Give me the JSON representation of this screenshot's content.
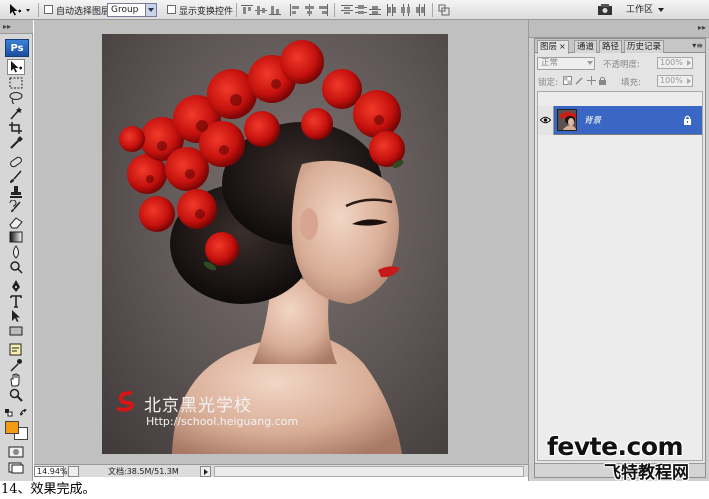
{
  "options_bar": {
    "auto_select_label": "自动选择图层",
    "auto_select_target": "Group",
    "show_transform_label": "显示变换控件",
    "workspace_label": "工作区"
  },
  "tools": {
    "logo": "Ps",
    "foreground_color": "#f39a15",
    "background_color": "#ffffff",
    "items": [
      "move-tool-icon",
      "marquee-tool-icon",
      "lasso-tool-icon",
      "magic-wand-tool-icon",
      "crop-tool-icon",
      "eyedropper-tool-icon",
      "healing-brush-tool-icon",
      "brush-tool-icon",
      "clone-stamp-tool-icon",
      "history-brush-tool-icon",
      "eraser-tool-icon",
      "gradient-tool-icon",
      "blur-tool-icon",
      "dodge-tool-icon",
      "pen-tool-icon",
      "type-tool-icon",
      "path-selection-tool-icon",
      "shape-tool-icon",
      "notes-tool-icon",
      "eyedropper2-tool-icon",
      "hand-tool-icon",
      "zoom-tool-icon"
    ]
  },
  "canvas": {
    "watermark_cn": "北京黑光学校",
    "watermark_url": "Http://school.heiguang.com"
  },
  "status_bar": {
    "zoom": "14.94%",
    "doc_size": "文档:38.5M/51.3M"
  },
  "layers_panel": {
    "tabs": [
      {
        "label": "图层",
        "active": true
      },
      {
        "label": "通道",
        "active": false
      },
      {
        "label": "路径",
        "active": false
      },
      {
        "label": "历史记录",
        "active": false
      }
    ],
    "close_glyph": "×",
    "blend_mode": "正常",
    "opacity_label": "不透明度:",
    "opacity_value": "100%",
    "lock_label": "锁定:",
    "fill_label": "填充:",
    "fill_value": "100%",
    "layers": [
      {
        "name": "背景",
        "selected": true,
        "visible": true,
        "locked": true
      }
    ],
    "selection_color": "#3a67c4"
  },
  "brand": {
    "english": "fevte.com",
    "chinese": "飞特教程网"
  },
  "caption": "14、效果完成。"
}
